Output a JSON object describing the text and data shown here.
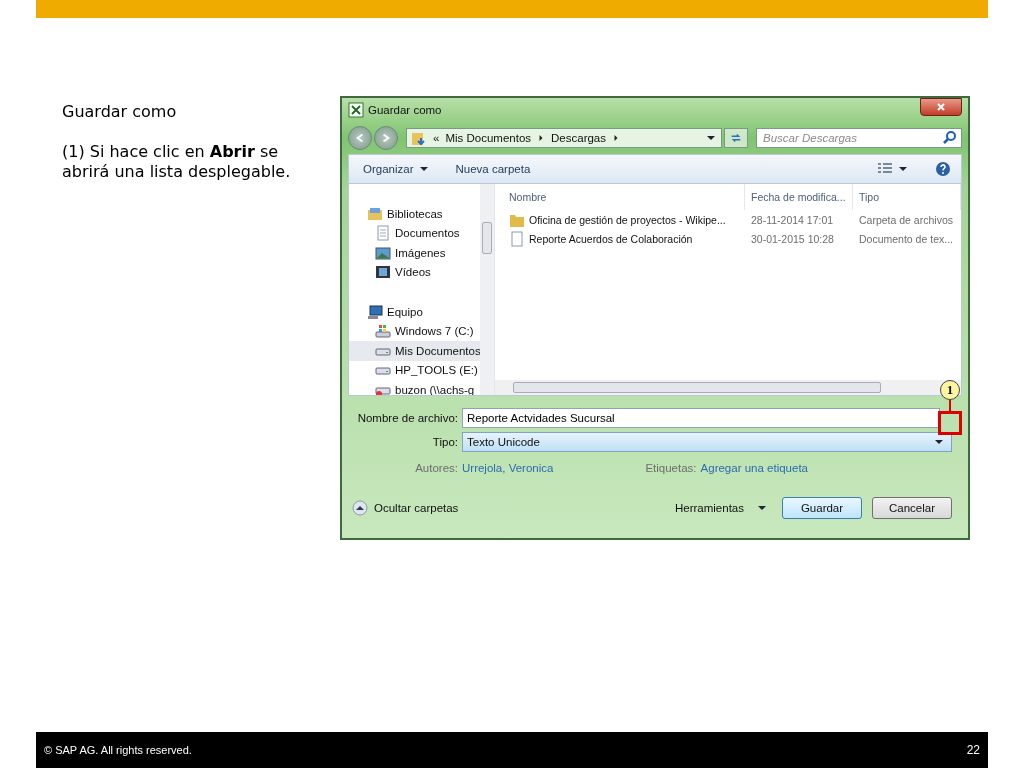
{
  "slide": {
    "title": "Guardar como",
    "instruction": "(1) Si hace clic en **Abrir** se abrirá una lista desplegable.",
    "footer": {
      "copyright": "©  SAP AG. All rights reserved.",
      "page": "22"
    }
  },
  "dialog": {
    "title": "Guardar como",
    "address": {
      "overflow": "«",
      "path": [
        "Mis Documentos",
        "Descargas"
      ]
    },
    "search": {
      "placeholder": "Buscar Descargas"
    },
    "toolbar": [
      "Organizar",
      "Nueva carpeta"
    ],
    "tree": [
      {
        "label": "Bibliotecas",
        "kind": "library",
        "selected": false,
        "children": [
          {
            "label": "Documentos",
            "kind": "document",
            "selected": false
          },
          {
            "label": "Imágenes",
            "kind": "image",
            "selected": false
          },
          {
            "label": "Vídeos",
            "kind": "video",
            "selected": false
          }
        ]
      },
      {
        "label": "Equipo",
        "kind": "computer",
        "selected": false,
        "children": [
          {
            "label": "Windows 7 (C:)",
            "kind": "system-drive",
            "selected": false
          },
          {
            "label": "Mis Documentos",
            "kind": "drive",
            "selected": true
          },
          {
            "label": "HP_TOOLS (E:)",
            "kind": "drive",
            "selected": false
          },
          {
            "label": "buzon (\\\\achs-g",
            "kind": "network-drive",
            "selected": false
          }
        ]
      }
    ],
    "columns": [
      "Nombre",
      "Fecha de modifica...",
      "Tipo"
    ],
    "files": [
      {
        "kind": "folder",
        "name": "Oficina de gestión de proyectos - Wikipe...",
        "date": "28-11-2014 17:01",
        "type": "Carpeta de archivos"
      },
      {
        "kind": "document",
        "name": "Reporte Acuerdos de Colaboración",
        "date": "30-01-2015 10:28",
        "type": "Documento de tex..."
      }
    ],
    "filename": {
      "label": "Nombre de archivo:",
      "value": "Reporte Actvidades Sucursal"
    },
    "file_type": {
      "label": "Tipo:",
      "value": "Texto Unicode"
    },
    "authors": {
      "label": "Autores:",
      "value": "Urrejola, Veronica"
    },
    "tags": {
      "label": "Etiquetas:",
      "value": "Agregar una etiqueta"
    },
    "hide_folders": "Ocultar carpetas",
    "tools": "Herramientas",
    "buttons": [
      "Guardar",
      "Cancelar"
    ],
    "callout": "1"
  }
}
